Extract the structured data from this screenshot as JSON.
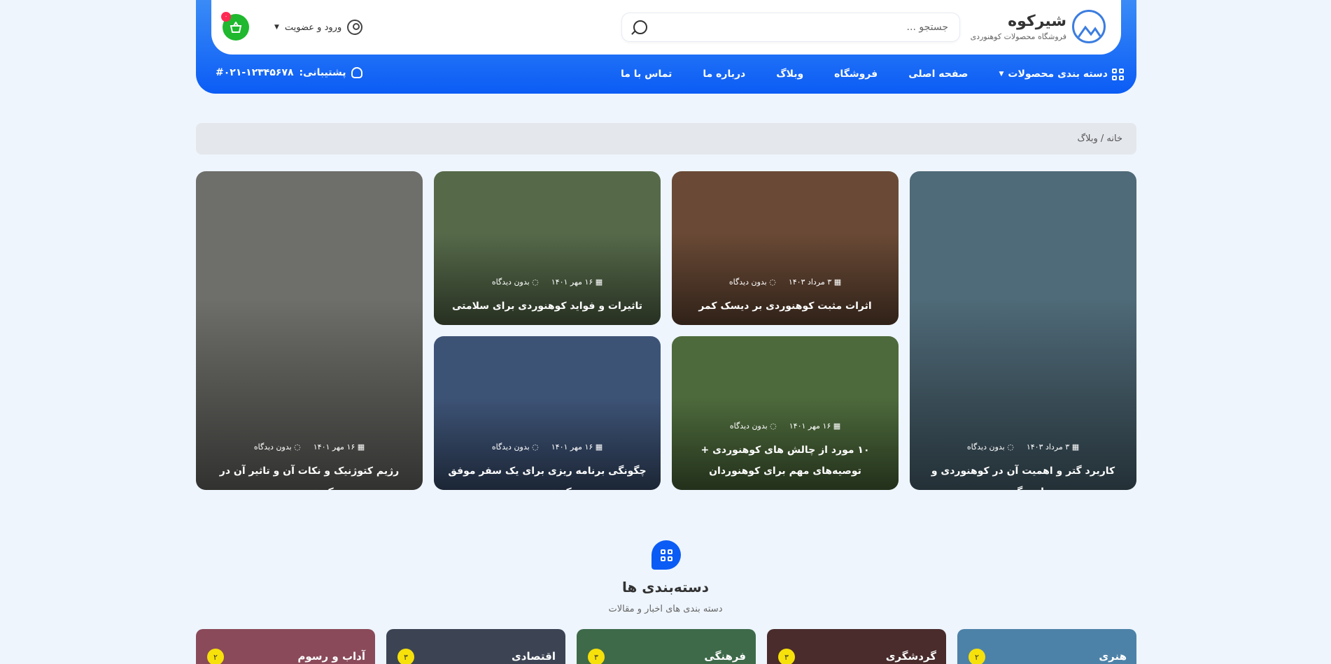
{
  "header": {
    "logo_title": "شیرکوه",
    "logo_subtitle": "فروشگاه محصولات کوهنوردی",
    "search_placeholder": "جستجو ...",
    "account_label": "ورود و عضویت",
    "cart_count": "۰"
  },
  "nav": {
    "items": [
      {
        "label": "دسته بندی محصولات"
      },
      {
        "label": "صفحه اصلی"
      },
      {
        "label": "فروشگاه"
      },
      {
        "label": "وبلاگ"
      },
      {
        "label": "درباره ما"
      },
      {
        "label": "تماس با ما"
      }
    ],
    "support_label": "پشتیبانی:",
    "support_phone": "#۰۲۱-۱۲۳۴۵۶۷۸"
  },
  "breadcrumb": "خانه / وبلاگ",
  "posts": [
    {
      "title": "کاربرد گتر و اهمیت آن در کوهنوردی و طبیعتگردی",
      "date": "۳ مرداد ۱۴۰۳",
      "comments": "بدون دیدگاه",
      "bg": "#4f6a78"
    },
    {
      "title": "اثرات مثبت کوهنوردی بر دیسک کمر",
      "date": "۳ مرداد ۱۴۰۳",
      "comments": "بدون دیدگاه",
      "bg": "#6a4a36"
    },
    {
      "title": "تاثیرات و فواید کوهنوردی برای سلامتی",
      "date": "۱۶ مهر ۱۴۰۱",
      "comments": "بدون دیدگاه",
      "bg": "#566a4a"
    },
    {
      "title": "رژیم کتوژنیک و نکات آن و تاثیر آن در کوهنوردی",
      "date": "۱۶ مهر ۱۴۰۱",
      "comments": "بدون دیدگاه",
      "bg": "#6e6e6a"
    },
    {
      "title": "۱۰ مورد از چالش های کوهنوردی + توصیه‌های مهم برای کوهنوردان",
      "date": "۱۶ مهر ۱۴۰۱",
      "comments": "بدون دیدگاه",
      "bg": "#4d6a3c"
    },
    {
      "title": "چگونگی برنامه ریزی برای یک سفر موفق کوهنوردی",
      "date": "۱۶ مهر ۱۴۰۱",
      "comments": "بدون دیدگاه",
      "bg": "#3d5376"
    }
  ],
  "categories_section": {
    "title": "دسته‌بندی ها",
    "subtitle": "دسته بندی های اخبار و مقالات",
    "items": [
      {
        "label": "هنری",
        "count": "۲",
        "bg": "#4d82a8"
      },
      {
        "label": "گردشگری",
        "count": "۳",
        "bg": "#4a2c2c"
      },
      {
        "label": "فرهنگی",
        "count": "۳",
        "bg": "#3e6a4a"
      },
      {
        "label": "اقتصادی",
        "count": "۳",
        "bg": "#3c4454"
      },
      {
        "label": "آداب و رسوم",
        "count": "۲",
        "bg": "#8a4a5a"
      }
    ]
  },
  "colors": {
    "brand_blue": "#0b5cf5",
    "cart_green": "#1fb82e",
    "badge_red": "#ff2a54"
  }
}
